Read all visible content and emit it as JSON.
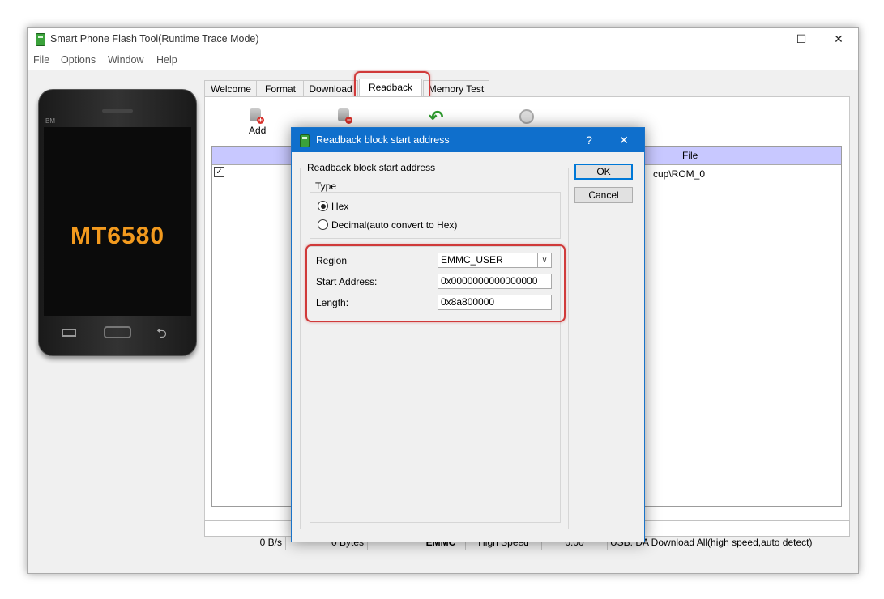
{
  "window": {
    "title": "Smart Phone Flash Tool(Runtime Trace Mode)",
    "controls": {
      "minimize": "—",
      "maximize": "☐",
      "close": "✕"
    }
  },
  "menu": [
    "File",
    "Options",
    "Window",
    "Help"
  ],
  "phone": {
    "chip": "MT6580",
    "brand": "BM"
  },
  "tabs": [
    "Welcome",
    "Format",
    "Download",
    "Readback",
    "Memory Test"
  ],
  "active_tab": "Readback",
  "toolbar": {
    "add_label": "Add"
  },
  "list": {
    "header_file": "File",
    "rows": [
      {
        "checked": true,
        "file": "cup\\ROM_0"
      }
    ]
  },
  "status": {
    "speed": "0 B/s",
    "bytes": "0 Bytes",
    "storage": "EMMC",
    "mode": "High Speed",
    "time": "0:00",
    "usb": "USB: DA Download All(high speed,auto detect)"
  },
  "dialog": {
    "title": "Readback block start address",
    "help": "?",
    "close": "✕",
    "group_label": "Readback block start address",
    "type_label": "Type",
    "options": [
      "Hex",
      "Decimal(auto convert to Hex)"
    ],
    "selected_option": "Hex",
    "region_label": "Region",
    "region_value": "EMMC_USER",
    "start_label": "Start Address:",
    "start_value": "0x0000000000000000",
    "length_label": "Length:",
    "length_value": "0x8a800000",
    "ok": "OK",
    "cancel": "Cancel"
  },
  "colors": {
    "dialog_titlebar": "#0f6fcc",
    "highlight": "#d03a3a",
    "list_header": "#c8c8ff",
    "chip_text": "#f39a1e"
  }
}
